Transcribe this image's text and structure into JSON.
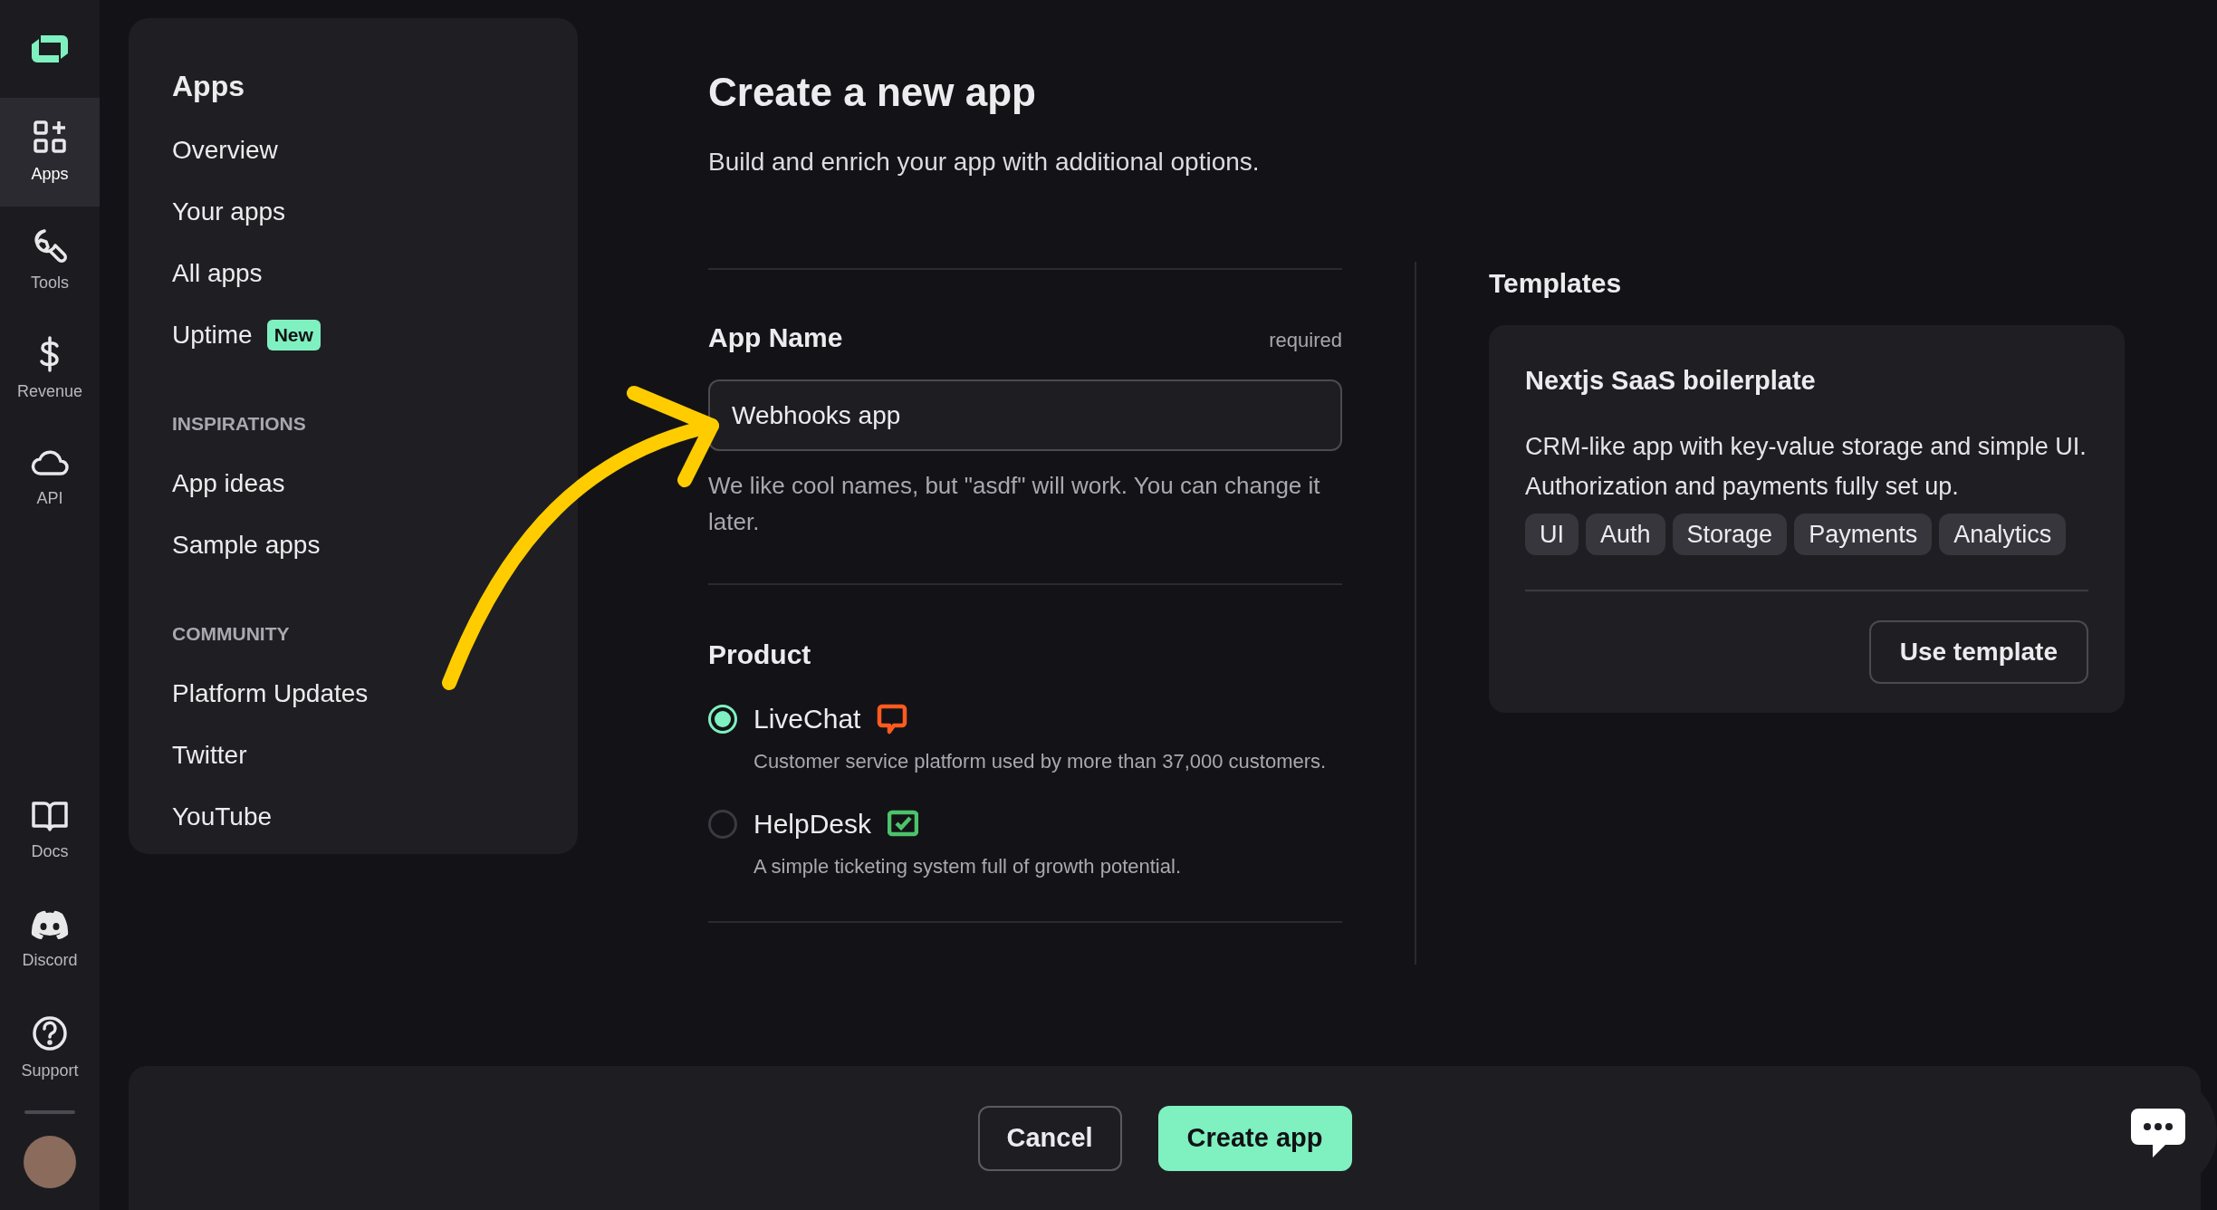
{
  "rail": {
    "top_items": [
      {
        "label": "Apps",
        "selected": true
      },
      {
        "label": "Tools",
        "selected": false
      },
      {
        "label": "Revenue",
        "selected": false
      },
      {
        "label": "API",
        "selected": false
      }
    ],
    "bottom_items": [
      {
        "label": "Docs",
        "selected": false
      },
      {
        "label": "Discord",
        "selected": false
      },
      {
        "label": "Support",
        "selected": false
      }
    ]
  },
  "sidebar": {
    "title": "Apps",
    "sections": [
      {
        "items": [
          {
            "label": "Overview"
          },
          {
            "label": "Your apps"
          },
          {
            "label": "All apps"
          },
          {
            "label": "Uptime",
            "badge": "New"
          }
        ]
      },
      {
        "heading": "INSPIRATIONS",
        "items": [
          {
            "label": "App ideas"
          },
          {
            "label": "Sample apps"
          }
        ]
      },
      {
        "heading": "COMMUNITY",
        "items": [
          {
            "label": "Platform Updates"
          },
          {
            "label": "Twitter"
          },
          {
            "label": "YouTube"
          }
        ]
      }
    ]
  },
  "form": {
    "title": "Create a new app",
    "subtitle": "Build and enrich your app with additional options.",
    "field": {
      "label": "App Name",
      "required": "required",
      "value": "Webhooks app",
      "hint": "We like cool names, but \"asdf\" will work. You can change it later."
    },
    "product": {
      "heading": "Product",
      "options": [
        {
          "name": "LiveChat",
          "description": "Customer service platform used by more than 37,000 customers.",
          "selected": true
        },
        {
          "name": "HelpDesk",
          "description": "A simple ticketing system full of growth potential.",
          "selected": false
        }
      ]
    }
  },
  "templates": {
    "heading": "Templates",
    "cards": [
      {
        "title": "Nextjs SaaS boilerplate",
        "description": "CRM-like app with key-value storage and simple UI. Authorization and payments fully set up.",
        "tags": [
          "UI",
          "Auth",
          "Storage",
          "Payments",
          "Analytics"
        ],
        "button": "Use template"
      }
    ]
  },
  "footer": {
    "buttons": [
      {
        "label": "Cancel",
        "kind": "secondary"
      },
      {
        "label": "Create app",
        "kind": "primary"
      }
    ]
  }
}
